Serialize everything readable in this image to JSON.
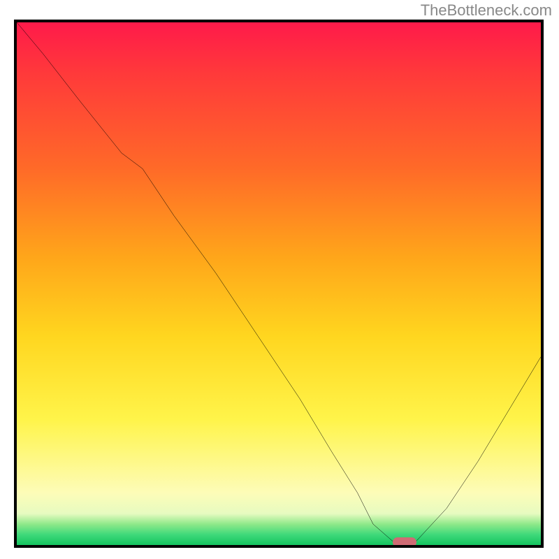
{
  "watermark": "TheBottleneck.com",
  "chart_data": {
    "type": "line",
    "title": "",
    "xlabel": "",
    "ylabel": "",
    "xlim": [
      0,
      100
    ],
    "ylim": [
      0,
      100
    ],
    "series": [
      {
        "name": "bottleneck-curve",
        "x": [
          0,
          5,
          12,
          20,
          24,
          30,
          38,
          46,
          54,
          60,
          65,
          68,
          72,
          76,
          82,
          88,
          94,
          100
        ],
        "y": [
          100,
          94,
          85,
          75,
          72,
          63,
          52,
          40,
          28,
          18,
          10,
          4,
          0.5,
          0.5,
          7,
          16,
          26,
          36
        ]
      }
    ],
    "marker": {
      "x": 74,
      "y": 0.5,
      "color": "#cf6b74"
    },
    "background_gradient": {
      "stops": [
        {
          "pct": 0,
          "color": "#ff1a4a"
        },
        {
          "pct": 10,
          "color": "#ff3a3a"
        },
        {
          "pct": 28,
          "color": "#ff6a28"
        },
        {
          "pct": 45,
          "color": "#ffa61a"
        },
        {
          "pct": 60,
          "color": "#ffd61f"
        },
        {
          "pct": 76,
          "color": "#fff44a"
        },
        {
          "pct": 90,
          "color": "#fdfcb8"
        },
        {
          "pct": 94,
          "color": "#e7fbc0"
        },
        {
          "pct": 96,
          "color": "#8fe98a"
        },
        {
          "pct": 98,
          "color": "#3fd97a"
        },
        {
          "pct": 100,
          "color": "#14c45f"
        }
      ]
    }
  }
}
